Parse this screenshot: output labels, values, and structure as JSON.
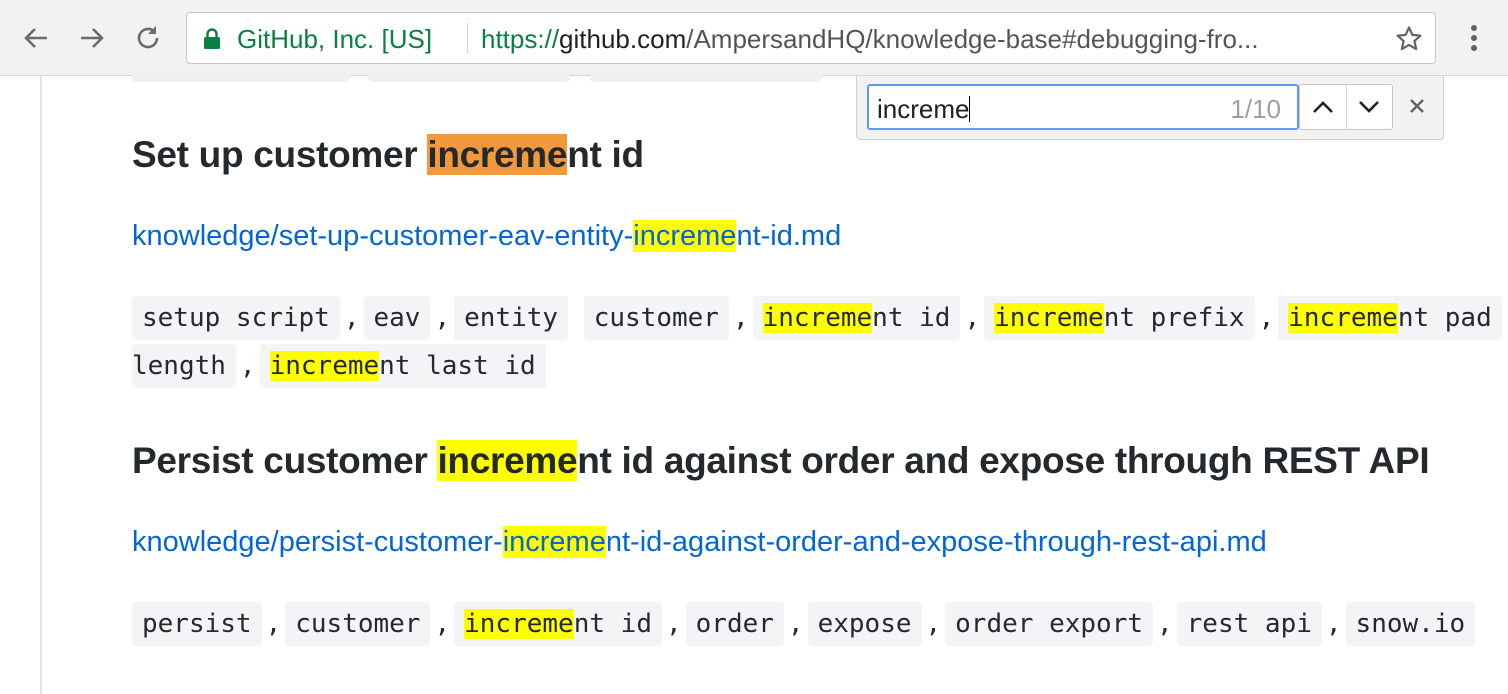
{
  "browser": {
    "site_identity": "GitHub, Inc. [US]",
    "url_scheme": "https://",
    "url_host": "github.com",
    "url_path": "/AmpersandHQ/knowledge-base#debugging-fro..."
  },
  "find_bar": {
    "query": "increme",
    "match_count": "1/10"
  },
  "sections": [
    {
      "title_before": "Set up customer ",
      "title_match": "increme",
      "title_after": "nt id",
      "path_before": "knowledge/set-up-customer-eav-entity-",
      "path_match": "increme",
      "path_after": "nt-id.md",
      "tags": [
        "setup script",
        "eav",
        "entity",
        "customer"
      ],
      "tag_increment_id": "nt id",
      "tag_increment_prefix": "nt prefix",
      "tag_increment_pad": "nt pad",
      "tag_pad_length": "length",
      "tag_increment_last": "nt last id"
    },
    {
      "title_before": "Persist customer ",
      "title_match": "increme",
      "title_after": "nt id against order and expose through REST API",
      "path_before": "knowledge/persist-customer-",
      "path_match": "increme",
      "path_after": "nt-id-against-order-and-expose-through-rest-api.md",
      "tag_persist": "persist",
      "tag_customer": "customer",
      "tag_increment_id": "nt id",
      "tags_after": [
        "order",
        "expose",
        "order export",
        "rest api",
        "snow.io"
      ]
    }
  ],
  "colors": {
    "link": "#0366d6",
    "match_highlight": "#ffff00",
    "current_match_highlight": "#f29a3b",
    "secure_green": "#0b8043"
  }
}
